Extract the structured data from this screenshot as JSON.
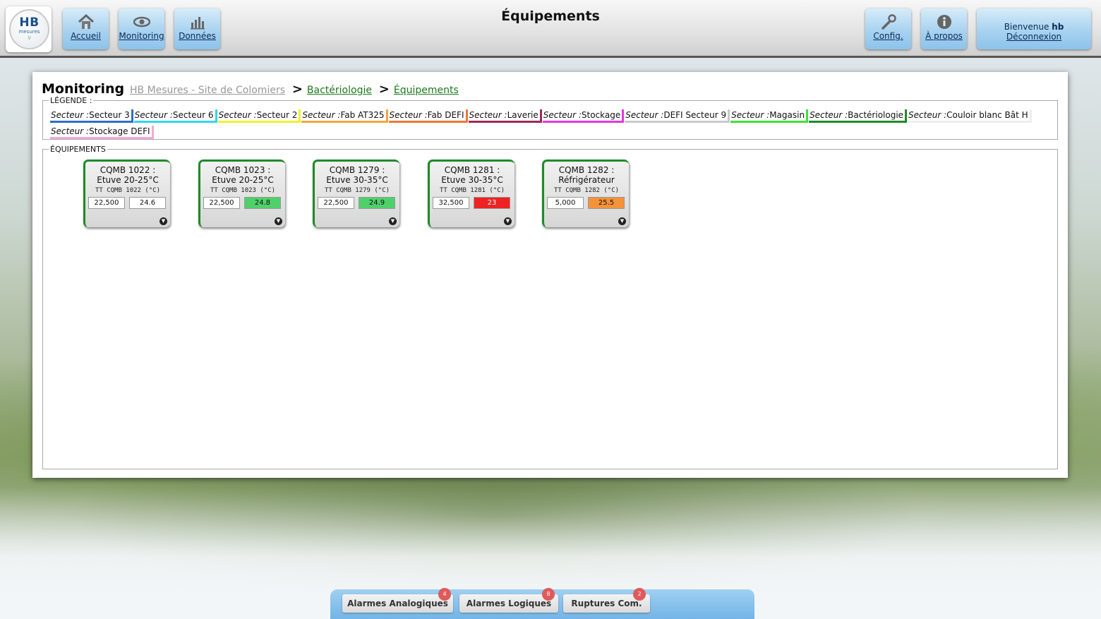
{
  "header": {
    "title": "Équipements",
    "logo": {
      "main": "HB",
      "sub": "mesures"
    },
    "nav": [
      {
        "id": "accueil",
        "label": "Accueil",
        "icon": "home-icon"
      },
      {
        "id": "monitoring",
        "label": "Monitoring",
        "icon": "eye-icon"
      },
      {
        "id": "donnees",
        "label": "Données",
        "icon": "chart-icon"
      },
      {
        "id": "config",
        "label": "Config.",
        "icon": "wrench-icon"
      },
      {
        "id": "apropos",
        "label": "À propos",
        "icon": "info-icon"
      }
    ],
    "user": {
      "welcome_prefix": "Bienvenue",
      "username": "hb",
      "logout_label": "Déconnexion"
    }
  },
  "breadcrumb": {
    "heading": "Monitoring",
    "site": "HB Mesures - Site de Colomiers",
    "sep": ">",
    "level1": "Bactériologie",
    "level2": "Équipements"
  },
  "legend": {
    "title": "LÉGENDE :",
    "prefix": "Secteur :",
    "items": [
      {
        "name": "Secteur 3",
        "color": "#2a6fc9"
      },
      {
        "name": "Secteur 6",
        "color": "#33d6e6"
      },
      {
        "name": "Secteur 2",
        "color": "#f2ef2c"
      },
      {
        "name": "Fab AT325",
        "color": "#f2a640"
      },
      {
        "name": "Fab DEFI",
        "color": "#f0773a"
      },
      {
        "name": "Laverie",
        "color": "#9c2a55"
      },
      {
        "name": "Stockage",
        "color": "#e436e0"
      },
      {
        "name": "DEFI Secteur 9",
        "color": "#c9c9c9"
      },
      {
        "name": "Magasin",
        "color": "#3ee03a"
      },
      {
        "name": "Bactériologie",
        "color": "#1f8a2a"
      },
      {
        "name": "Couloir blanc Bât H",
        "color": "#eeeeee"
      },
      {
        "name": "Stockage DEFI",
        "color": "#f7a9d2"
      }
    ]
  },
  "equipments": {
    "title": "ÉQUIPEMENTS",
    "cards": [
      {
        "line1": "CQMB 1022 :",
        "line2": "Etuve 20-25°C",
        "sensor": "TT CQMB 1022 (°C)",
        "threshold": "22,500",
        "value": "24.6",
        "status_color": "#ffffff",
        "value_text_color": "#111111"
      },
      {
        "line1": "CQMB 1023 :",
        "line2": "Etuve 20-25°C",
        "sensor": "TT CQMB 1023 (°C)",
        "threshold": "22,500",
        "value": "24.8",
        "status_color": "#4fd16a",
        "value_text_color": "#111111"
      },
      {
        "line1": "CQMB 1279 :",
        "line2": "Etuve 30-35°C",
        "sensor": "TT CQMB 1279 (°C)",
        "threshold": "22,500",
        "value": "24.9",
        "status_color": "#4fd16a",
        "value_text_color": "#111111"
      },
      {
        "line1": "CQMB 1281 :",
        "line2": "Etuve 30-35°C",
        "sensor": "TT CQMB 1281 (°C)",
        "threshold": "32,500",
        "value": "23",
        "status_color": "#ee2222",
        "value_text_color": "#ffffff"
      },
      {
        "line1": "CQMB 1282 :",
        "line2": "Réfrigérateur",
        "sensor": "TT CQMB 1282 (°C)",
        "threshold": "5,000",
        "value": "25.5",
        "status_color": "#f4923a",
        "value_text_color": "#111111"
      }
    ]
  },
  "alarms": [
    {
      "label": "Alarmes Analogiques",
      "count": "4"
    },
    {
      "label": "Alarmes Logiques",
      "count": "8"
    },
    {
      "label": "Ruptures Com.",
      "count": "2"
    }
  ]
}
